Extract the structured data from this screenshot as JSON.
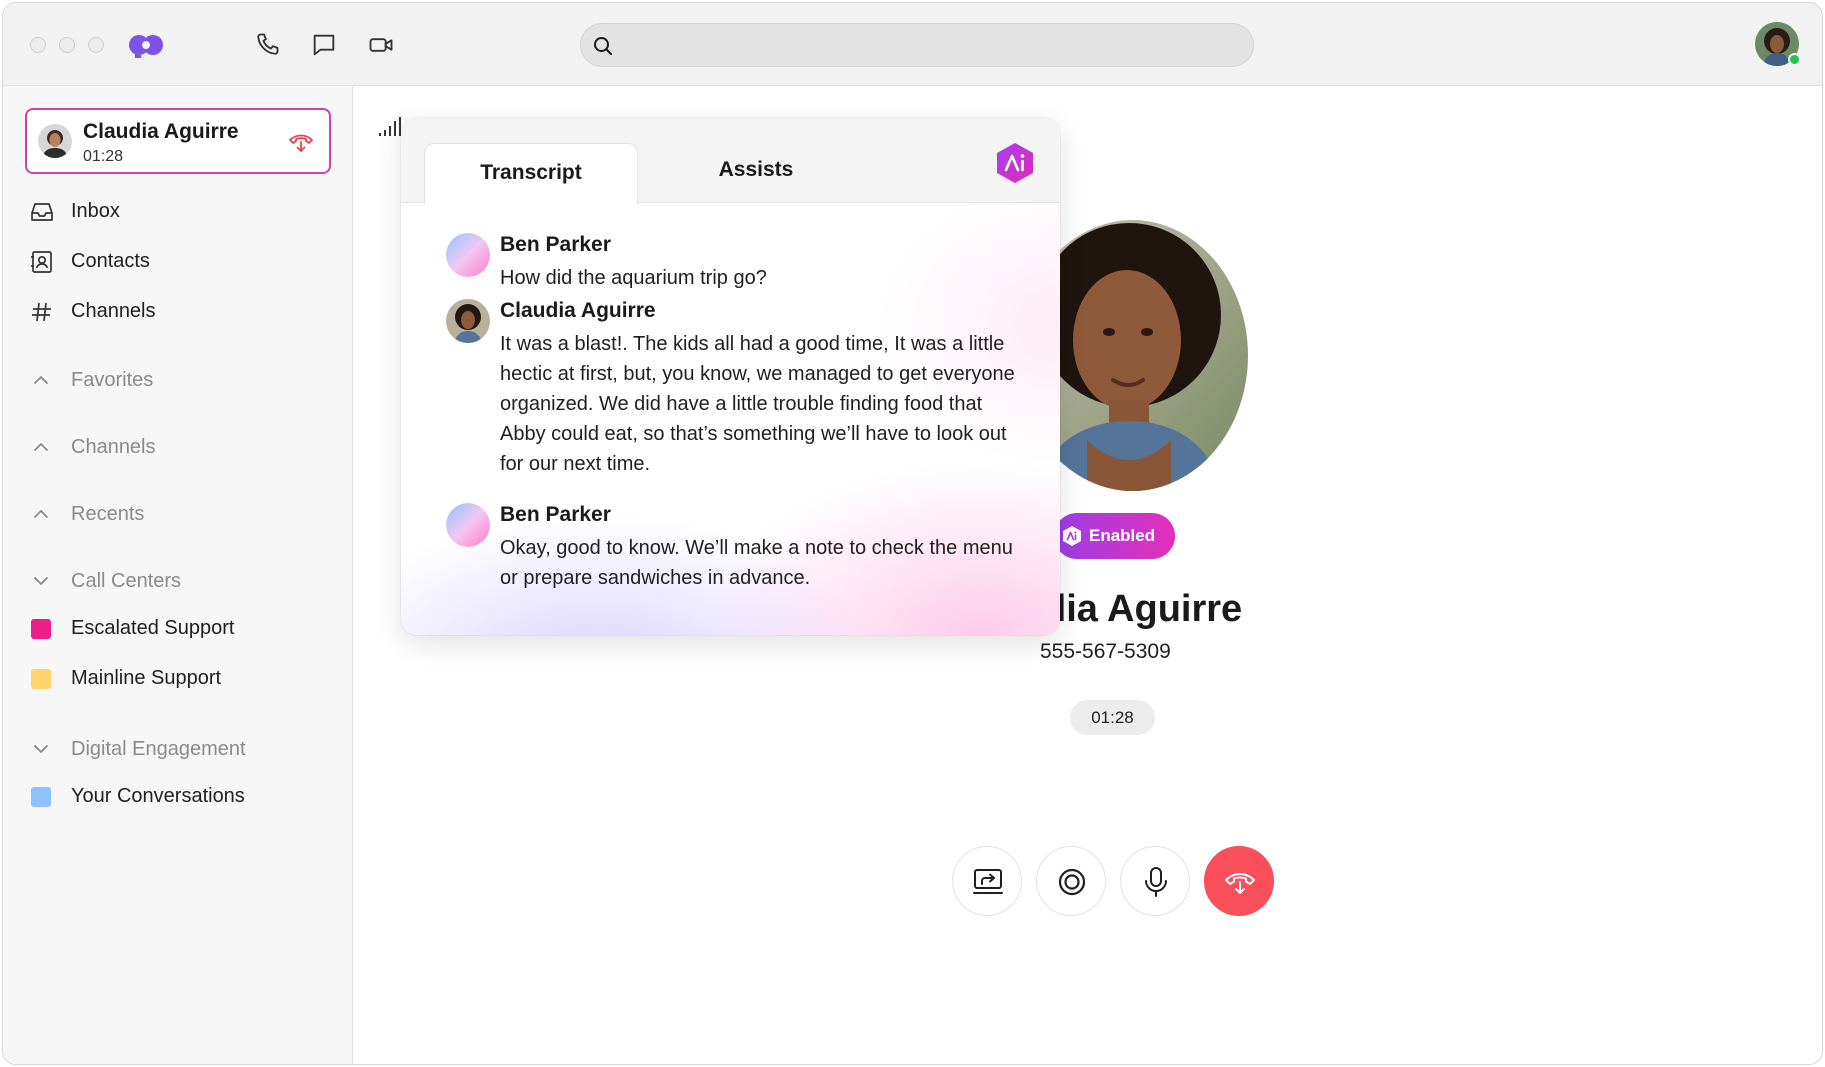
{
  "search": {
    "placeholder": ""
  },
  "active_call": {
    "name": "Claudia Aguirre",
    "duration": "01:28"
  },
  "nav": [
    {
      "label": "Inbox",
      "icon": "inbox-icon"
    },
    {
      "label": "Contacts",
      "icon": "contacts-icon"
    },
    {
      "label": "Channels",
      "icon": "hash-icon"
    }
  ],
  "sections": {
    "favorites": "Favorites",
    "channels": "Channels",
    "recents": "Recents",
    "call_centers": "Call Centers",
    "digital_engagement": "Digital Engagement"
  },
  "call_centers": [
    {
      "label": "Escalated Support",
      "color": "#ee1d8a"
    },
    {
      "label": "Mainline Support",
      "color": "#ffd56a"
    }
  ],
  "digital_engagement": [
    {
      "label": "Your Conversations",
      "color": "#8dc2ff"
    }
  ],
  "transcript_panel": {
    "tabs": [
      "Transcript",
      "Assists"
    ],
    "messages": [
      {
        "speaker": "Ben Parker",
        "text": "How did the aquarium trip go?"
      },
      {
        "speaker": "Claudia Aguirre",
        "text": "It was a blast!. The kids all had a good time, It was a little hectic at first, but, you know, we managed to get everyone organized. We did have a little trouble finding food that Abby could eat, so that’s something we’ll have to look out for our next time."
      },
      {
        "speaker": "Ben Parker",
        "text": "Okay, good to know. We’ll make a note to check the menu or prepare sandwiches in advance."
      }
    ]
  },
  "contact": {
    "ai_status": "Enabled",
    "name_visible": "dia Aguirre",
    "phone": "555-567-5309",
    "timer": "01:28"
  },
  "colors": {
    "accent": "#d13fb1",
    "end_call": "#f84f5a",
    "ai_gradient_start": "#9b3ee8",
    "ai_gradient_end": "#e42fb7",
    "online": "#27c24c"
  }
}
